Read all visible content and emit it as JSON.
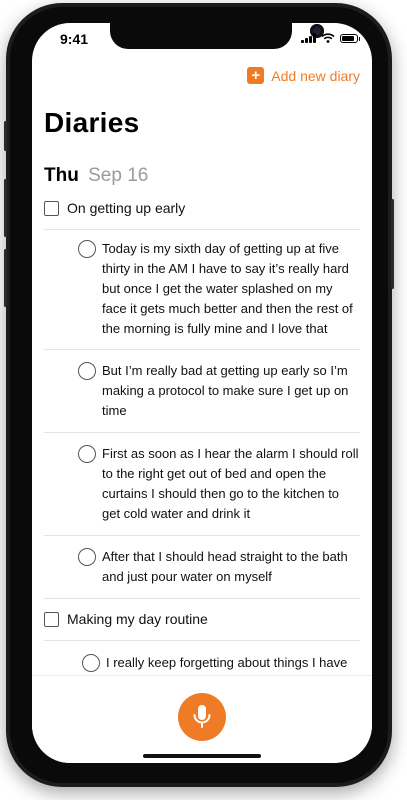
{
  "status_bar": {
    "time": "9:41"
  },
  "header": {
    "add_button_label": "Add new diary"
  },
  "page": {
    "title": "Diaries"
  },
  "date": {
    "day": "Thu",
    "rest": "Sep 16"
  },
  "diaries": [
    {
      "title": "On getting up early",
      "entries": [
        "Today is my sixth day of getting up at five thirty in the AM I have to say it’s really hard but once I get the water splashed on my face it gets much better and then the rest of the morning is fully mine and I love that",
        "But I’m really bad at getting up early so I’m making a protocol to make sure I get up on time",
        "First as soon as I hear the alarm I should roll to the right get out of bed and open the curtains I should then go to the kitchen to get cold water and drink it",
        "After that I should head straight to the bath and just pour water on myself"
      ]
    },
    {
      "title": "Making my day routine",
      "entries": [
        "I really keep forgetting about things I have"
      ]
    }
  ],
  "colors": {
    "accent": "#f07b26"
  },
  "icons": {
    "add": "plus-icon",
    "record": "microphone-icon",
    "status": [
      "signal-icon",
      "wifi-icon",
      "battery-icon"
    ]
  }
}
